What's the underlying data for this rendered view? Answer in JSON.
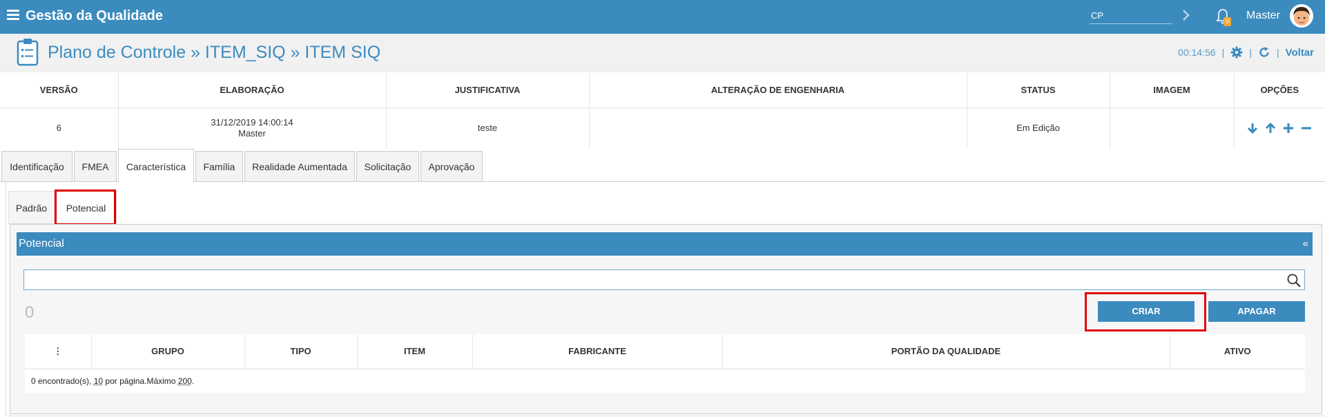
{
  "app": {
    "title": "Gestão da Qualidade"
  },
  "topbar": {
    "cp_value": "CP",
    "notifications": "0",
    "user": "Master"
  },
  "page": {
    "title": "Plano de Controle » ITEM_SIQ » ITEM SIQ",
    "timer": "00:14:56",
    "back_label": "Voltar"
  },
  "versions": {
    "headers": [
      "VERSÃO",
      "ELABORAÇÃO",
      "JUSTIFICATIVA",
      "ALTERAÇÃO DE ENGENHARIA",
      "STATUS",
      "IMAGEM",
      "OPÇÕES"
    ],
    "row": {
      "version": "6",
      "date": "31/12/2019 14:00:14",
      "author": "Master",
      "justification": "teste",
      "engineering_change": "",
      "status": "Em Edição",
      "image": ""
    }
  },
  "tabs": [
    "Identificação",
    "FMEA",
    "Característica",
    "Família",
    "Realidade Aumentada",
    "Solicitação",
    "Aprovação"
  ],
  "active_tab": "Característica",
  "subtabs": [
    "Padrão",
    "Potencial"
  ],
  "active_subtab": "Potencial",
  "section": {
    "title": "Potencial",
    "collapse": "«",
    "search_value": "",
    "count": "0",
    "create_label": "CRIAR",
    "delete_label": "APAGAR"
  },
  "grid": {
    "headers": [
      "⋮",
      "GRUPO",
      "TIPO",
      "ITEM",
      "FABRICANTE",
      "PORTÃO DA QUALIDADE",
      "ATIVO"
    ],
    "footer_prefix": "0 encontrado(s), ",
    "per_page": "10",
    "footer_mid": " por página.Máximo ",
    "max": "200",
    "footer_end": "."
  },
  "colors": {
    "primary": "#3b8bbf",
    "highlight": "#e00000",
    "badge": "#f0a830"
  }
}
